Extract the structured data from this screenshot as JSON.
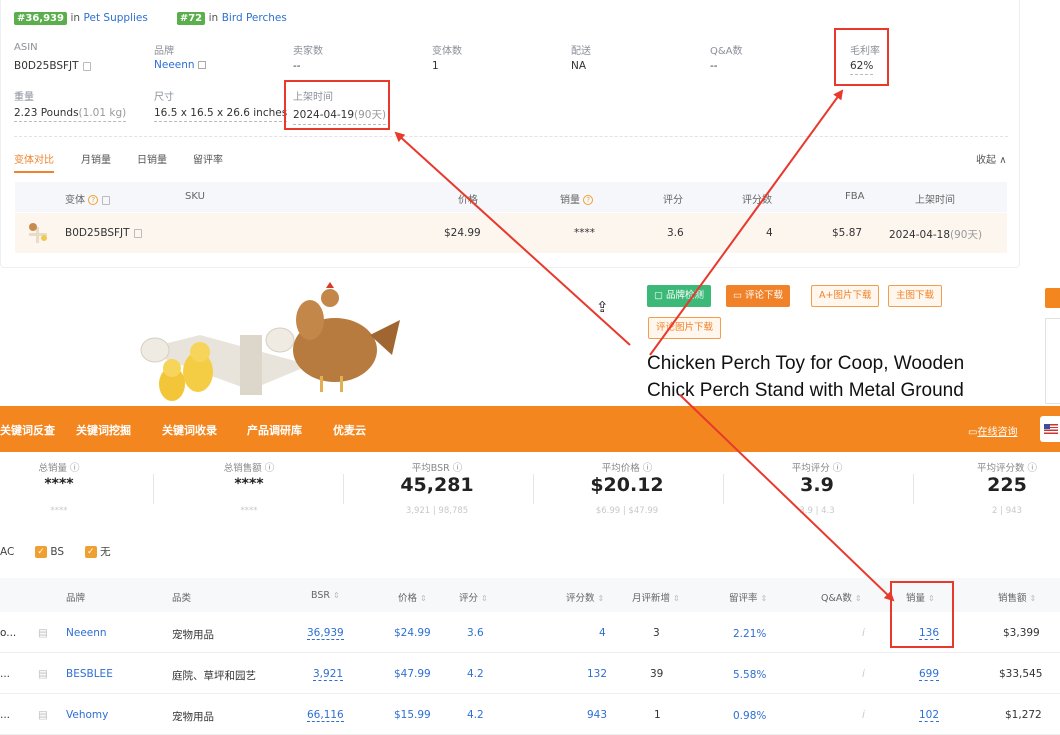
{
  "rank": {
    "badge1": "#36,939",
    "in1": "in",
    "cat1": "Pet Supplies",
    "badge2": "#72",
    "in2": "in",
    "cat2": "Bird Perches"
  },
  "info": {
    "asin_label": "ASIN",
    "asin": "B0D25BSFJT",
    "brand_label": "品牌",
    "brand": "Neeenn",
    "sellers_label": "卖家数",
    "sellers": "--",
    "variants_label": "变体数",
    "variants": "1",
    "shipping_label": "配送",
    "shipping": "NA",
    "qa_label": "Q&A数",
    "qa": "--",
    "margin_label": "毛利率",
    "margin": "62%",
    "weight_label": "重量",
    "weight": "2.23 Pounds",
    "weight_kg": "(1.01 kg)",
    "size_label": "尺寸",
    "size": "16.5 x 16.5 x 26.6 inches",
    "listed_label": "上架时间",
    "listed": "2024-04-19",
    "listed_days": "(90天)"
  },
  "tabs": [
    "变体对比",
    "月销量",
    "日销量",
    "留评率"
  ],
  "collapse": "收起",
  "variant_table": {
    "headers": {
      "variant": "变体",
      "sku": "SKU",
      "price": "价格",
      "sales": "销量",
      "rating": "评分",
      "reviews": "评分数",
      "fba": "FBA",
      "listed": "上架时间"
    },
    "row": {
      "variant": "B0D25BSFJT",
      "sku": "",
      "price": "$24.99",
      "sales": "****",
      "rating": "3.6",
      "reviews": "4",
      "fba": "$5.87",
      "listed": "2024-04-18",
      "listed_days": "(90天)"
    }
  },
  "product": {
    "buttons": [
      "品牌检测",
      "评论下载",
      "A+图片下载",
      "主图下载",
      "评论图片下载"
    ],
    "title_line1": "Chicken Perch Toy for Coop, Wooden",
    "title_line2": "Chick Perch Stand with Metal Ground"
  },
  "nav": {
    "items": [
      "关键词反查",
      "关键词挖掘",
      "关键词收录",
      "产品调研库",
      "优麦云"
    ],
    "online": "在线咨询"
  },
  "stats": [
    {
      "label": "总销量",
      "value": "****",
      "range": "****"
    },
    {
      "label": "总销售额",
      "value": "****",
      "range": "****"
    },
    {
      "label": "平均BSR",
      "value": "45,281",
      "range": "3,921 | 98,785"
    },
    {
      "label": "平均价格",
      "value": "$20.12",
      "range": "$6.99 | $47.99"
    },
    {
      "label": "平均评分",
      "value": "3.9",
      "range": "3.9 | 4.3"
    },
    {
      "label": "平均评分数",
      "value": "225",
      "range": "2 | 943"
    }
  ],
  "filters": {
    "ac": "AC",
    "bs": "BS",
    "none": "无"
  },
  "main_table": {
    "headers": {
      "brand": "品牌",
      "category": "品类",
      "bsr": "BSR",
      "price": "价格",
      "rating": "评分",
      "reviews": "评分数",
      "monthly_new": "月评新增",
      "review_rate": "留评率",
      "qa": "Q&A数",
      "sales": "销量",
      "revenue": "销售额"
    },
    "rows": [
      {
        "prefix": "o...",
        "brand": "Neeenn",
        "category": "宠物用品",
        "bsr": "36,939",
        "price": "$24.99",
        "rating": "3.6",
        "reviews": "4",
        "monthly_new": "3",
        "review_rate": "2.21%",
        "qa": "i",
        "sales": "136",
        "revenue": "$3,399"
      },
      {
        "prefix": "...",
        "brand": "BESBLEE",
        "category": "庭院、草坪和园艺",
        "bsr": "3,921",
        "price": "$47.99",
        "rating": "4.2",
        "reviews": "132",
        "monthly_new": "39",
        "review_rate": "5.58%",
        "qa": "i",
        "sales": "699",
        "revenue": "$33,545"
      },
      {
        "prefix": "...",
        "brand": "Vehomy",
        "category": "宠物用品",
        "bsr": "66,116",
        "price": "$15.99",
        "rating": "4.2",
        "reviews": "943",
        "monthly_new": "1",
        "review_rate": "0.98%",
        "qa": "i",
        "sales": "102",
        "revenue": "$1,272"
      }
    ]
  }
}
